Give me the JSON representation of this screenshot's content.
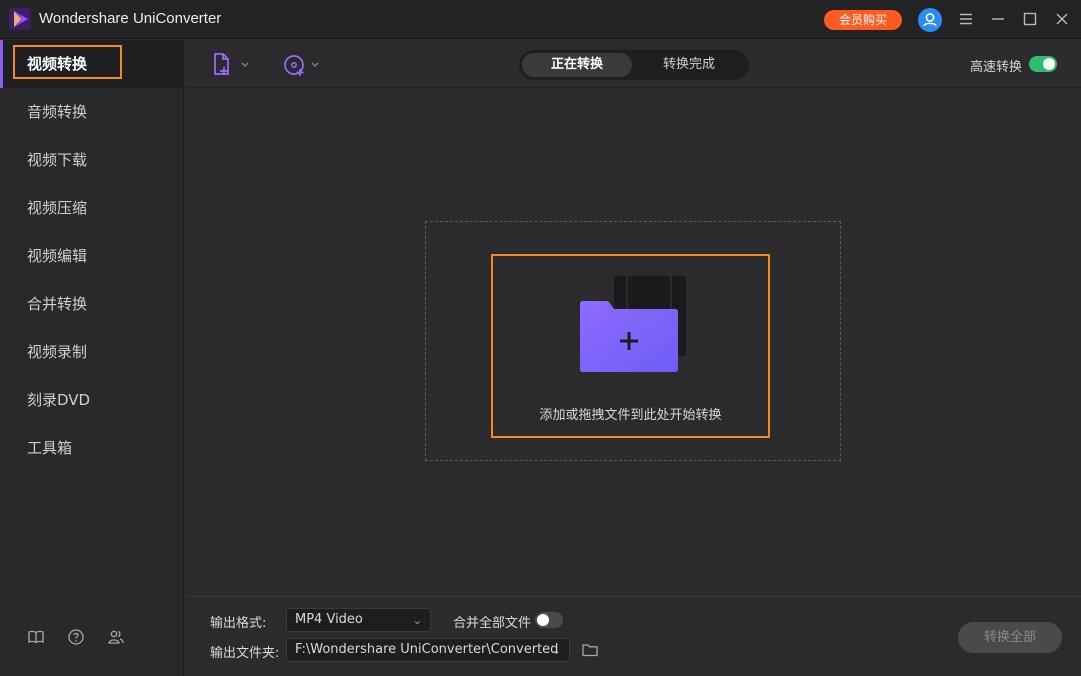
{
  "app": {
    "title": "Wondershare UniConverter",
    "vip_label": "会员购买"
  },
  "sidebar": {
    "items": [
      {
        "label": "视频转换"
      },
      {
        "label": "音频转换"
      },
      {
        "label": "视频下载"
      },
      {
        "label": "视频压缩"
      },
      {
        "label": "视频编辑"
      },
      {
        "label": "合并转换"
      },
      {
        "label": "视频录制"
      },
      {
        "label": "刻录DVD"
      },
      {
        "label": "工具箱"
      }
    ],
    "active_index": 0
  },
  "toolbar": {
    "tabs": [
      {
        "label": "正在转换"
      },
      {
        "label": "转换完成"
      }
    ],
    "high_speed_label": "高速转换",
    "high_speed_on": true
  },
  "dropzone": {
    "hint": "添加或拖拽文件到此处开始转换"
  },
  "bottom": {
    "output_format_label": "输出格式:",
    "output_format_value": "MP4 Video",
    "merge_label": "合并全部文件",
    "merge_on": false,
    "output_folder_label": "输出文件夹:",
    "output_folder_value": "F:\\Wondershare UniConverter\\Converted",
    "convert_all_label": "转换全部"
  },
  "colors": {
    "accent": "#8b5cf6",
    "highlight": "#f28a1d",
    "vip": "#ff5a1f",
    "toggle_on": "#2bbd6e",
    "avatar": "#2b8cf6"
  }
}
